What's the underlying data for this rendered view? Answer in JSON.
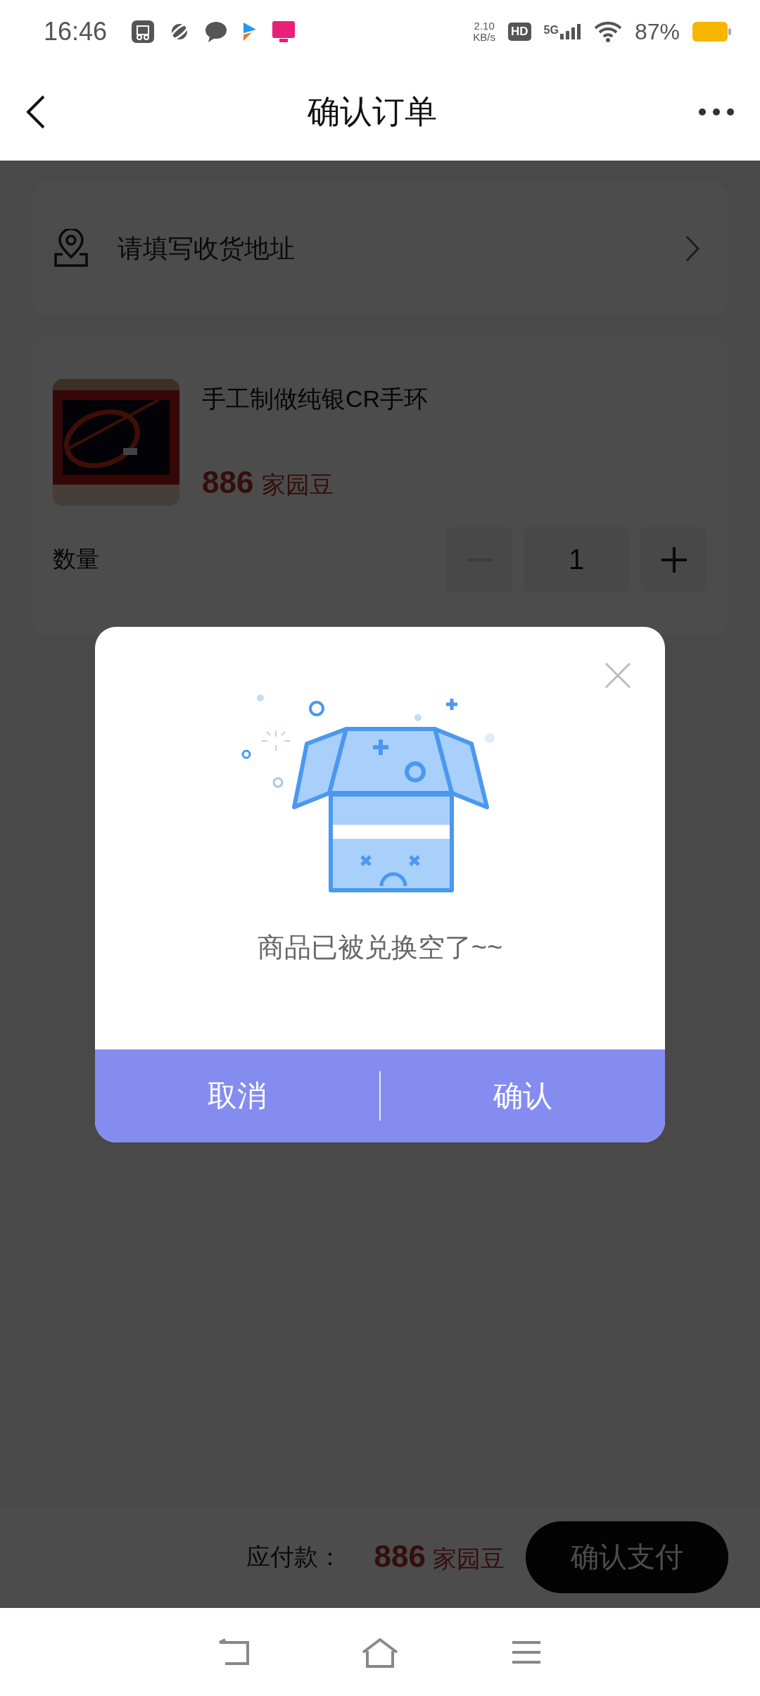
{
  "status_bar": {
    "time": "16:46",
    "speed_value": "2.10",
    "speed_unit": "KB/s",
    "hd": "HD",
    "network": "5G",
    "battery": "87%"
  },
  "header": {
    "title": "确认订单"
  },
  "address": {
    "placeholder": "请填写收货地址"
  },
  "product": {
    "kind": "picture",
    "title": "手工制做纯银CR手环",
    "price": "886",
    "unit": "家园豆",
    "quantity_label": "数量",
    "quantity": "1",
    "decrease_disabled": true
  },
  "footer": {
    "label": "应付款：",
    "price": "886",
    "unit": "家园豆",
    "pay_button": "确认支付"
  },
  "dialog": {
    "message": "商品已被兑换空了~~",
    "buttons": [
      {
        "label": "取消"
      },
      {
        "label": "确认"
      }
    ]
  }
}
